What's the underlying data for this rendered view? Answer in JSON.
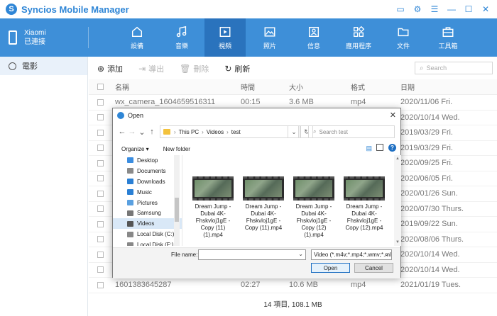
{
  "app": {
    "title": "Syncios Mobile Manager",
    "accent": "#3e8fd8"
  },
  "device": {
    "name": "Xiaomi",
    "status": "已連接"
  },
  "nav": {
    "items": [
      {
        "label": "設備",
        "icon": "home-icon"
      },
      {
        "label": "音樂",
        "icon": "music-icon"
      },
      {
        "label": "視頻",
        "icon": "video-icon"
      },
      {
        "label": "照片",
        "icon": "photo-icon"
      },
      {
        "label": "信息",
        "icon": "message-icon"
      },
      {
        "label": "應用程序",
        "icon": "apps-icon"
      },
      {
        "label": "文件",
        "icon": "folder-icon"
      },
      {
        "label": "工具箱",
        "icon": "toolbox-icon"
      }
    ],
    "active_index": 2
  },
  "sidebar": {
    "items": [
      {
        "label": "電影",
        "icon": "film-icon"
      }
    ]
  },
  "toolbar": {
    "add": "添加",
    "export": "導出",
    "delete": "刪除",
    "refresh": "刷新",
    "search_placeholder": "Search"
  },
  "table": {
    "headers": [
      "名稱",
      "時間",
      "大小",
      "格式",
      "日期"
    ],
    "rows": [
      [
        "wx_camera_1604659516311",
        "00:15",
        "3.6 MB",
        "mp4",
        "2020/11/06 Fri."
      ],
      [
        "",
        "",
        "",
        "",
        "2020/10/14 Wed."
      ],
      [
        "",
        "",
        "",
        "",
        "2019/03/29 Fri."
      ],
      [
        "",
        "",
        "",
        "",
        "2019/03/29 Fri."
      ],
      [
        "",
        "",
        "",
        "",
        "2020/09/25 Fri."
      ],
      [
        "",
        "",
        "",
        "",
        "2020/06/05 Fri."
      ],
      [
        "",
        "",
        "",
        "",
        "2020/01/26 Sun."
      ],
      [
        "",
        "",
        "",
        "",
        "2020/07/30 Thurs."
      ],
      [
        "",
        "",
        "",
        "",
        "2019/09/22 Sun."
      ],
      [
        "",
        "",
        "",
        "",
        "2020/08/06 Thurs."
      ],
      [
        "",
        "",
        "",
        "",
        "2020/10/14 Wed."
      ],
      [
        "",
        "",
        "",
        "",
        "2020/10/14 Wed."
      ],
      [
        "1601383645287",
        "02:27",
        "10.6 MB",
        "mp4",
        "2021/01/19 Tues."
      ]
    ]
  },
  "footer": "14 項目, 108.1 MB",
  "dialog": {
    "title": "Open",
    "path": [
      "This PC",
      "Videos",
      "test"
    ],
    "search_placeholder": "Search test",
    "organize": "Organize ▾",
    "new_folder": "New folder",
    "nav_items": [
      {
        "label": "Desktop",
        "color": "#3b8de0"
      },
      {
        "label": "Documents",
        "color": "#8a8a8a"
      },
      {
        "label": "Downloads",
        "color": "#2a7fd4"
      },
      {
        "label": "Music",
        "color": "#2a7fd4"
      },
      {
        "label": "Pictures",
        "color": "#5aa0e0"
      },
      {
        "label": "Samsung",
        "color": "#777777"
      },
      {
        "label": "Videos",
        "color": "#555555"
      },
      {
        "label": "Local Disk (C:)",
        "color": "#888888"
      },
      {
        "label": "Local Disk (F:)",
        "color": "#888888"
      }
    ],
    "selected_nav": 6,
    "files": [
      {
        "name": "Dream Jump - Dubai 4K-Fhskvloj1gE - Copy (11)(1).mp4"
      },
      {
        "name": "Dream Jump - Dubai 4K-Fhskvloj1gE - Copy (11).mp4"
      },
      {
        "name": "Dream Jump - Dubai 4K-Fhskvloj1gE - Copy (12)(1).mp4"
      },
      {
        "name": "Dream Jump - Dubai 4K-Fhskvloj1gE - Copy (12).mp4"
      }
    ],
    "file_name_label": "File name:",
    "file_name_value": "",
    "file_type": "Video (*.m4v;*.mp4;*.wmv;*.ml",
    "open_label": "Open",
    "cancel_label": "Cancel"
  }
}
